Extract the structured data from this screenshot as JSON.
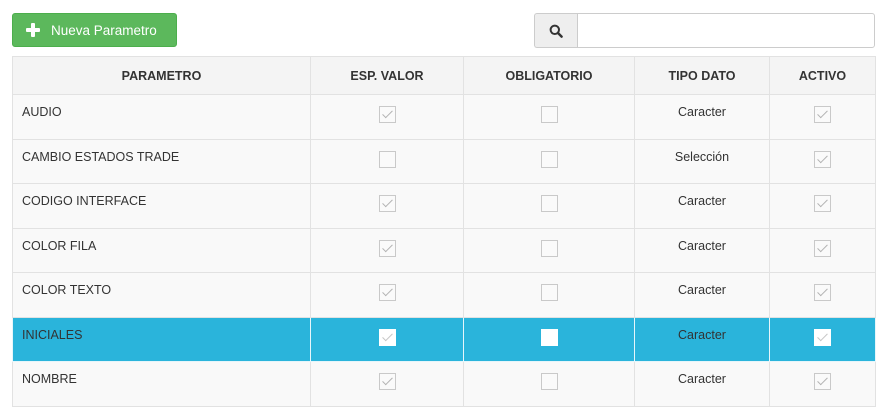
{
  "toolbar": {
    "new_button_label": "Nueva Parametro",
    "new_button_icon": "plus-icon",
    "search_icon": "search-icon",
    "search_value": "",
    "search_placeholder": ""
  },
  "colors": {
    "new_button": "#5cb85c",
    "selected_row": "#2ab4db",
    "header_bg": "#f4f4f4",
    "row_bg": "#f9f9f9"
  },
  "table": {
    "columns": [
      "PARAMETRO",
      "ESP. VALOR",
      "OBLIGATORIO",
      "TIPO DATO",
      "ACTIVO"
    ],
    "selected_row_index": 5,
    "rows": [
      {
        "parametro": "AUDIO",
        "esp_valor": true,
        "obligatorio": false,
        "tipo_dato": "Caracter",
        "activo": true
      },
      {
        "parametro": "CAMBIO ESTADOS TRADE",
        "esp_valor": false,
        "obligatorio": false,
        "tipo_dato": "Selección",
        "activo": true
      },
      {
        "parametro": "CODIGO INTERFACE",
        "esp_valor": true,
        "obligatorio": false,
        "tipo_dato": "Caracter",
        "activo": true
      },
      {
        "parametro": "COLOR FILA",
        "esp_valor": true,
        "obligatorio": false,
        "tipo_dato": "Caracter",
        "activo": true
      },
      {
        "parametro": "COLOR TEXTO",
        "esp_valor": true,
        "obligatorio": false,
        "tipo_dato": "Caracter",
        "activo": true
      },
      {
        "parametro": "INICIALES",
        "esp_valor": true,
        "obligatorio": false,
        "tipo_dato": "Caracter",
        "activo": true
      },
      {
        "parametro": "NOMBRE",
        "esp_valor": true,
        "obligatorio": false,
        "tipo_dato": "Caracter",
        "activo": true
      }
    ]
  }
}
